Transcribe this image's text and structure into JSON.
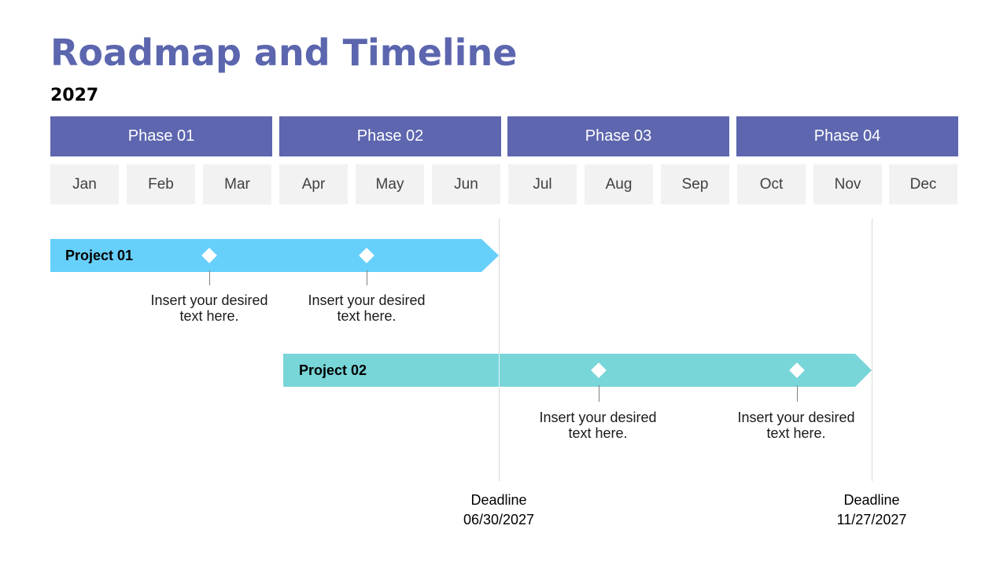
{
  "title": "Roadmap and Timeline",
  "year": "2027",
  "colors": {
    "accent": "#5d66ae",
    "month_bg": "#f2f2f2",
    "project_01": "#66d0fb",
    "project_02": "#78d5d8"
  },
  "phases": [
    {
      "label": "Phase 01"
    },
    {
      "label": "Phase 02"
    },
    {
      "label": "Phase 03"
    },
    {
      "label": "Phase 04"
    }
  ],
  "months": [
    "Jan",
    "Feb",
    "Mar",
    "Apr",
    "May",
    "Jun",
    "Jul",
    "Aug",
    "Sep",
    "Oct",
    "Nov",
    "Dec"
  ],
  "projects": [
    {
      "label": "Project 01",
      "start_month": "Jan",
      "end_date": "06/30/2027",
      "milestones": [
        {
          "text_line1": "Insert your desired",
          "text_line2": "text here."
        },
        {
          "text_line1": "Insert your desired",
          "text_line2": "text here."
        }
      ]
    },
    {
      "label": "Project 02",
      "start_month": "Apr",
      "end_date": "11/27/2027",
      "milestones": [
        {
          "text_line1": "Insert your desired",
          "text_line2": "text here."
        },
        {
          "text_line1": "Insert your desired",
          "text_line2": "text here."
        }
      ]
    }
  ],
  "deadlines": [
    {
      "label": "Deadline",
      "date": "06/30/2027"
    },
    {
      "label": "Deadline",
      "date": "11/27/2027"
    }
  ]
}
